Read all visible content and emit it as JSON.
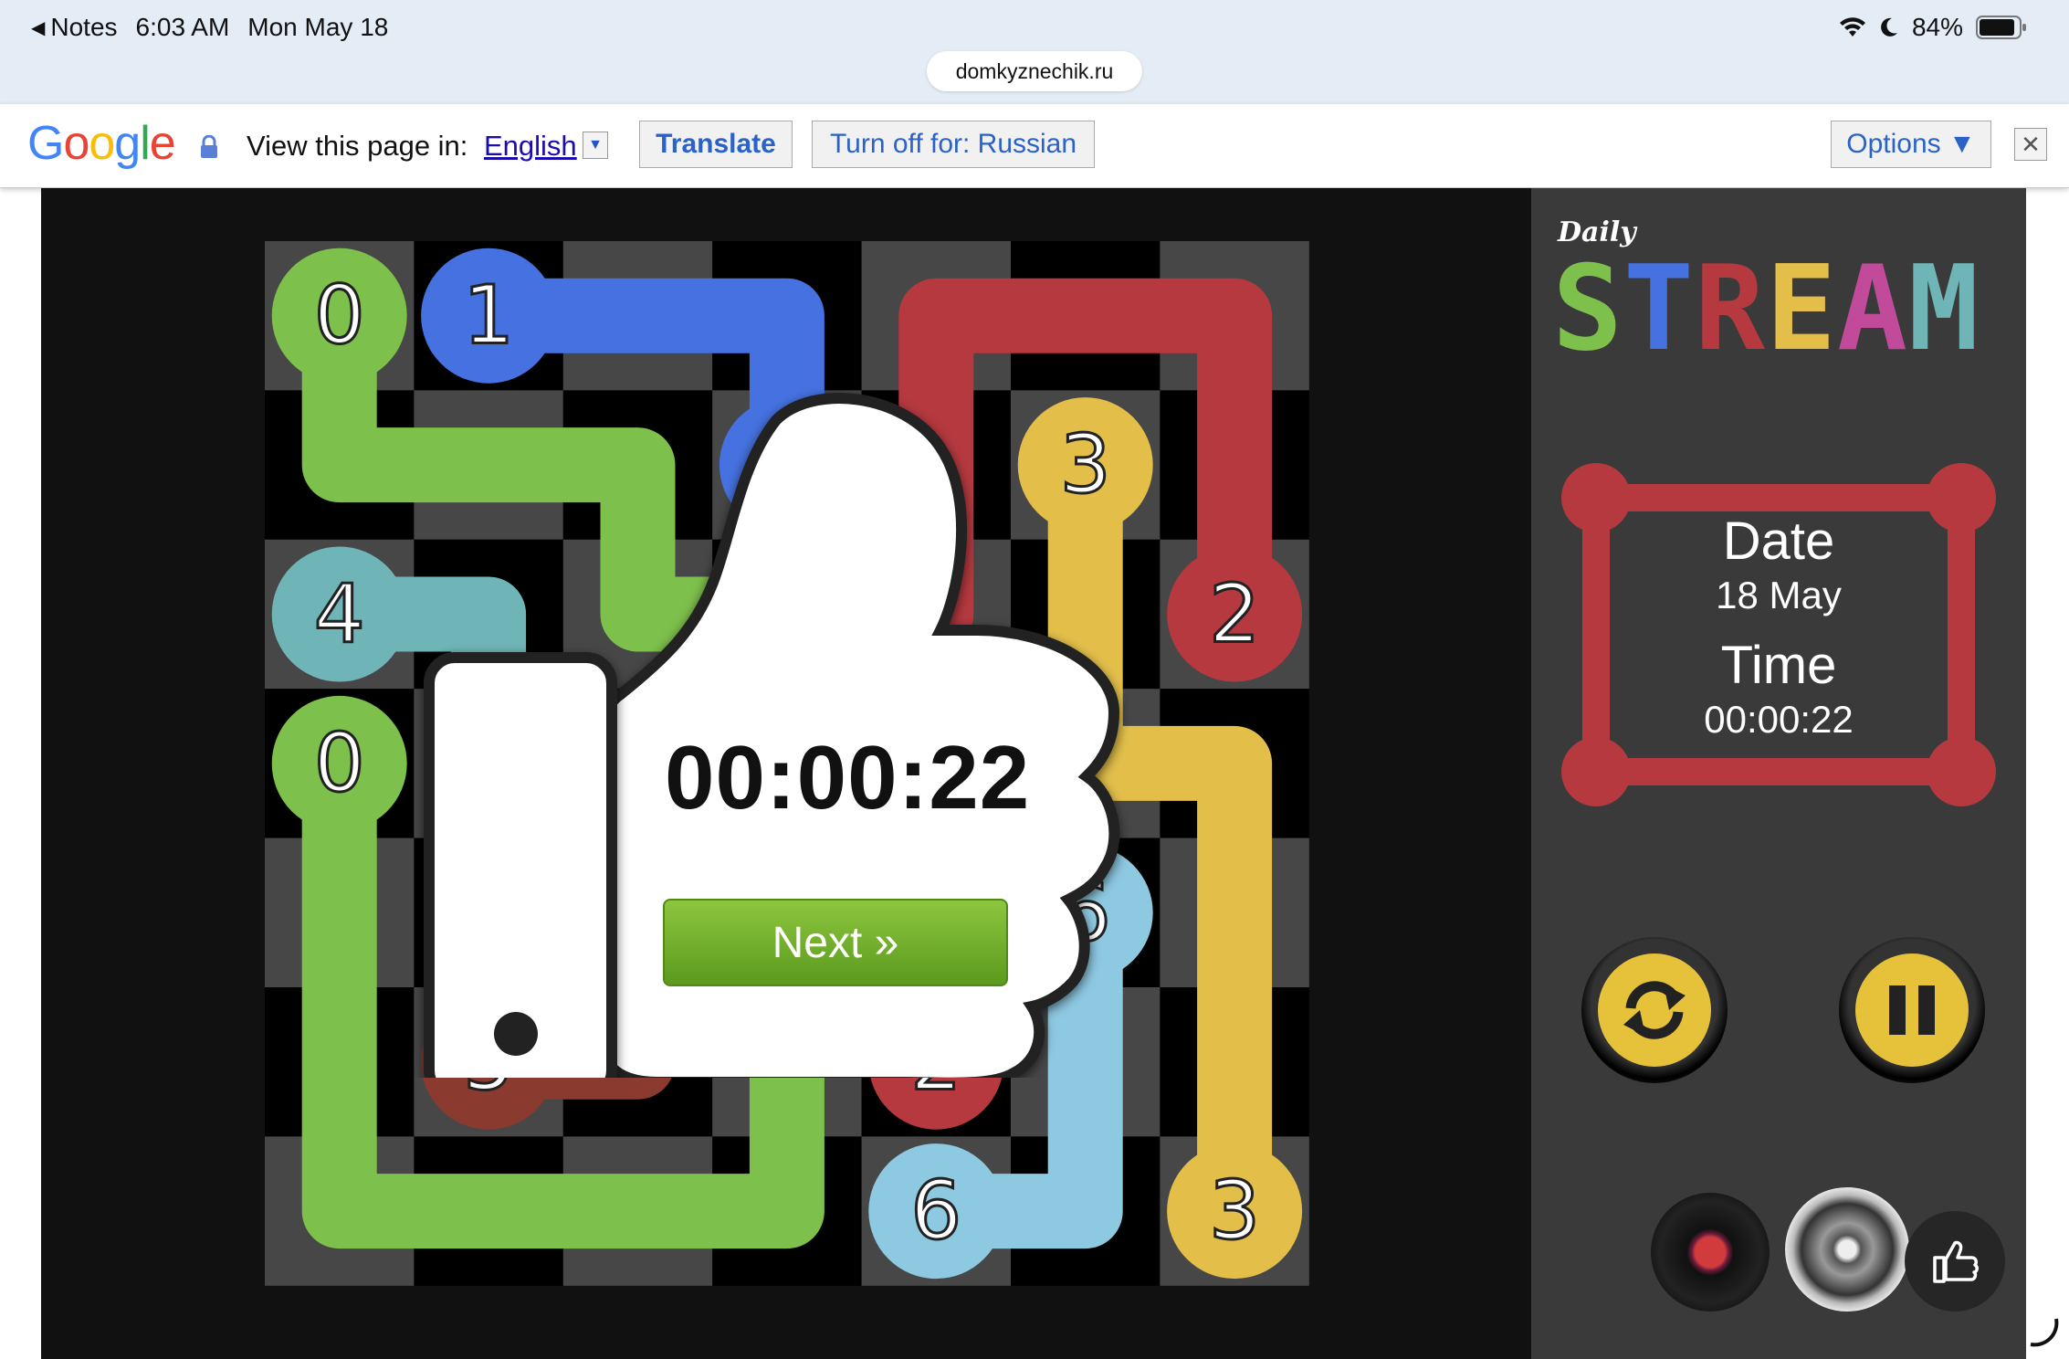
{
  "status_bar": {
    "back_label": "Notes",
    "time": "6:03 AM",
    "date": "Mon May 18",
    "battery": "84%",
    "url": "domkyznechik.ru"
  },
  "translate_bar": {
    "logo": "Google",
    "prompt": "View this page in:",
    "language": "English",
    "translate_label": "Translate",
    "turn_off_label": "Turn off for: Russian",
    "options_label": "Options ▼"
  },
  "game": {
    "logo_small": "Daily",
    "logo_big": "STREAM",
    "date_heading": "Date",
    "date_value": "18 May",
    "time_heading": "Time",
    "time_value": "00:00:22",
    "overlay_timer": "00:00:22",
    "next_label": "Next »",
    "colors": {
      "0": "#7dc04b",
      "1": "#4572e0",
      "2": "#b5393f",
      "3": "#e3bf4a",
      "4": "#6fb5b8",
      "5": "#8a3a2e",
      "6": "#8ec9e2"
    },
    "endpoints": [
      {
        "id": "0",
        "row": 0,
        "col": 0
      },
      {
        "id": "1",
        "row": 0,
        "col": 1
      },
      {
        "id": "1",
        "row": 1,
        "col": 3
      },
      {
        "id": "3",
        "row": 1,
        "col": 5
      },
      {
        "id": "4",
        "row": 2,
        "col": 0
      },
      {
        "id": "2",
        "row": 2,
        "col": 6
      },
      {
        "id": "0",
        "row": 3,
        "col": 0
      },
      {
        "id": "6",
        "row": 4,
        "col": 5
      },
      {
        "id": "5",
        "row": 5,
        "col": 1
      },
      {
        "id": "2",
        "row": 5,
        "col": 4
      },
      {
        "id": "6",
        "row": 6,
        "col": 4
      },
      {
        "id": "3",
        "row": 6,
        "col": 6
      }
    ],
    "paths": [
      {
        "id": "0",
        "cells": [
          [
            0,
            0
          ],
          [
            1,
            0
          ],
          [
            1,
            1
          ],
          [
            1,
            2
          ],
          [
            2,
            2
          ],
          [
            2,
            3
          ],
          [
            3,
            3
          ]
        ]
      },
      {
        "id": "1",
        "cells": [
          [
            0,
            1
          ],
          [
            0,
            2
          ],
          [
            0,
            3
          ],
          [
            1,
            3
          ]
        ]
      },
      {
        "id": "2",
        "cells": [
          [
            2,
            4
          ],
          [
            1,
            4
          ],
          [
            0,
            4
          ],
          [
            0,
            5
          ],
          [
            0,
            6
          ],
          [
            1,
            6
          ],
          [
            2,
            6
          ]
        ]
      },
      {
        "id": "3",
        "cells": [
          [
            1,
            5
          ],
          [
            2,
            5
          ],
          [
            3,
            5
          ],
          [
            3,
            6
          ],
          [
            4,
            6
          ],
          [
            5,
            6
          ],
          [
            6,
            6
          ]
        ]
      },
      {
        "id": "4",
        "cells": [
          [
            2,
            0
          ],
          [
            2,
            1
          ],
          [
            3,
            1
          ]
        ]
      },
      {
        "id": "0",
        "cells": [
          [
            3,
            0
          ],
          [
            4,
            0
          ],
          [
            5,
            0
          ],
          [
            6,
            0
          ],
          [
            6,
            1
          ],
          [
            6,
            2
          ],
          [
            6,
            3
          ],
          [
            5,
            3
          ]
        ]
      },
      {
        "id": "5",
        "cells": [
          [
            5,
            1
          ],
          [
            5,
            2
          ]
        ]
      },
      {
        "id": "6",
        "cells": [
          [
            4,
            5
          ],
          [
            5,
            5
          ],
          [
            6,
            5
          ],
          [
            6,
            4
          ]
        ]
      },
      {
        "id": "2",
        "cells": [
          [
            5,
            4
          ],
          [
            4,
            4
          ]
        ]
      }
    ]
  }
}
